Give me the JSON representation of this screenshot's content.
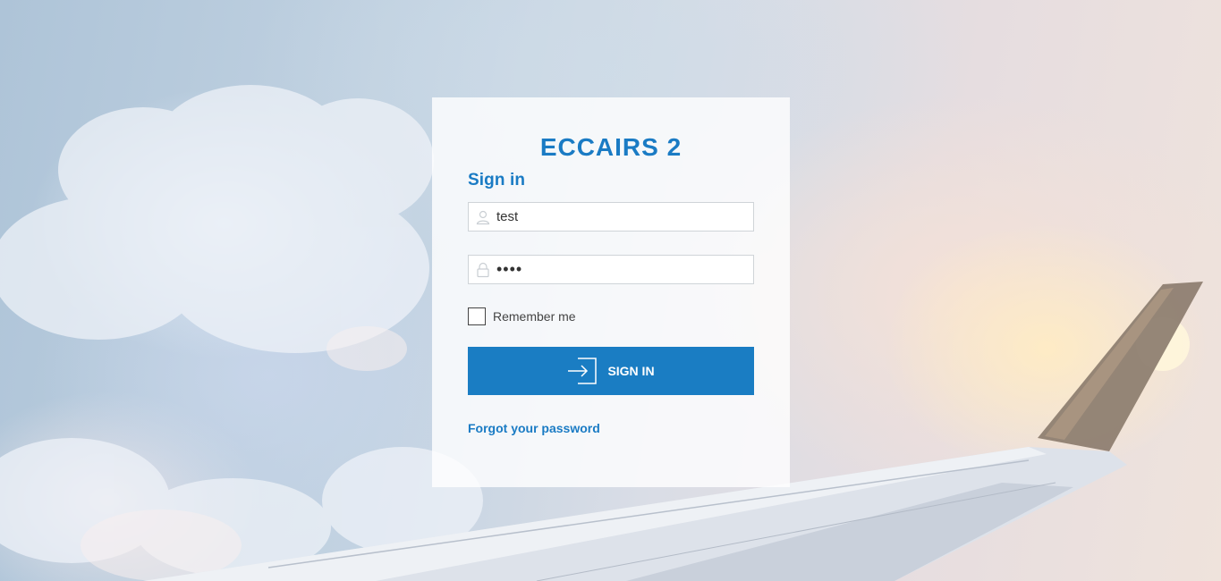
{
  "brand": {
    "logo_text": "ECCAIRS 2",
    "accent": "#1a7bc4"
  },
  "form": {
    "title": "Sign in",
    "username": {
      "value": "test",
      "icon": "user-icon"
    },
    "password": {
      "value": "••••",
      "icon": "lock-icon"
    },
    "remember_label": "Remember me",
    "remember_checked": false,
    "submit_label": "SIGN IN",
    "submit_icon": "sign-in-arrow-icon",
    "forgot_label": "Forgot your password"
  }
}
